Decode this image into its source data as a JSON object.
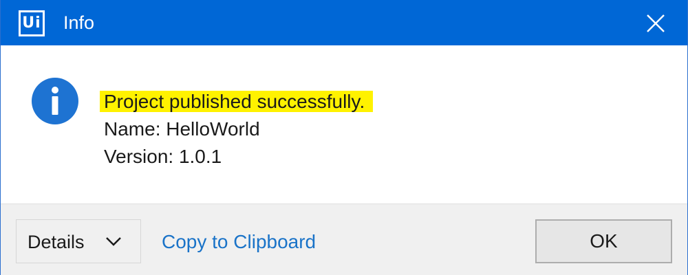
{
  "window": {
    "logo_text": "Ui",
    "title": "Info",
    "close_icon": "close-icon",
    "accent_color": "#0067d6"
  },
  "message": {
    "icon": "info-icon",
    "line1": "Project published successfully.",
    "line2": "Name: HelloWorld",
    "line3": "Version: 1.0.1",
    "highlight_color": "#fff200"
  },
  "footer": {
    "details_label": "Details",
    "details_icon": "chevron-down-icon",
    "copy_label": "Copy to Clipboard",
    "ok_label": "OK"
  }
}
